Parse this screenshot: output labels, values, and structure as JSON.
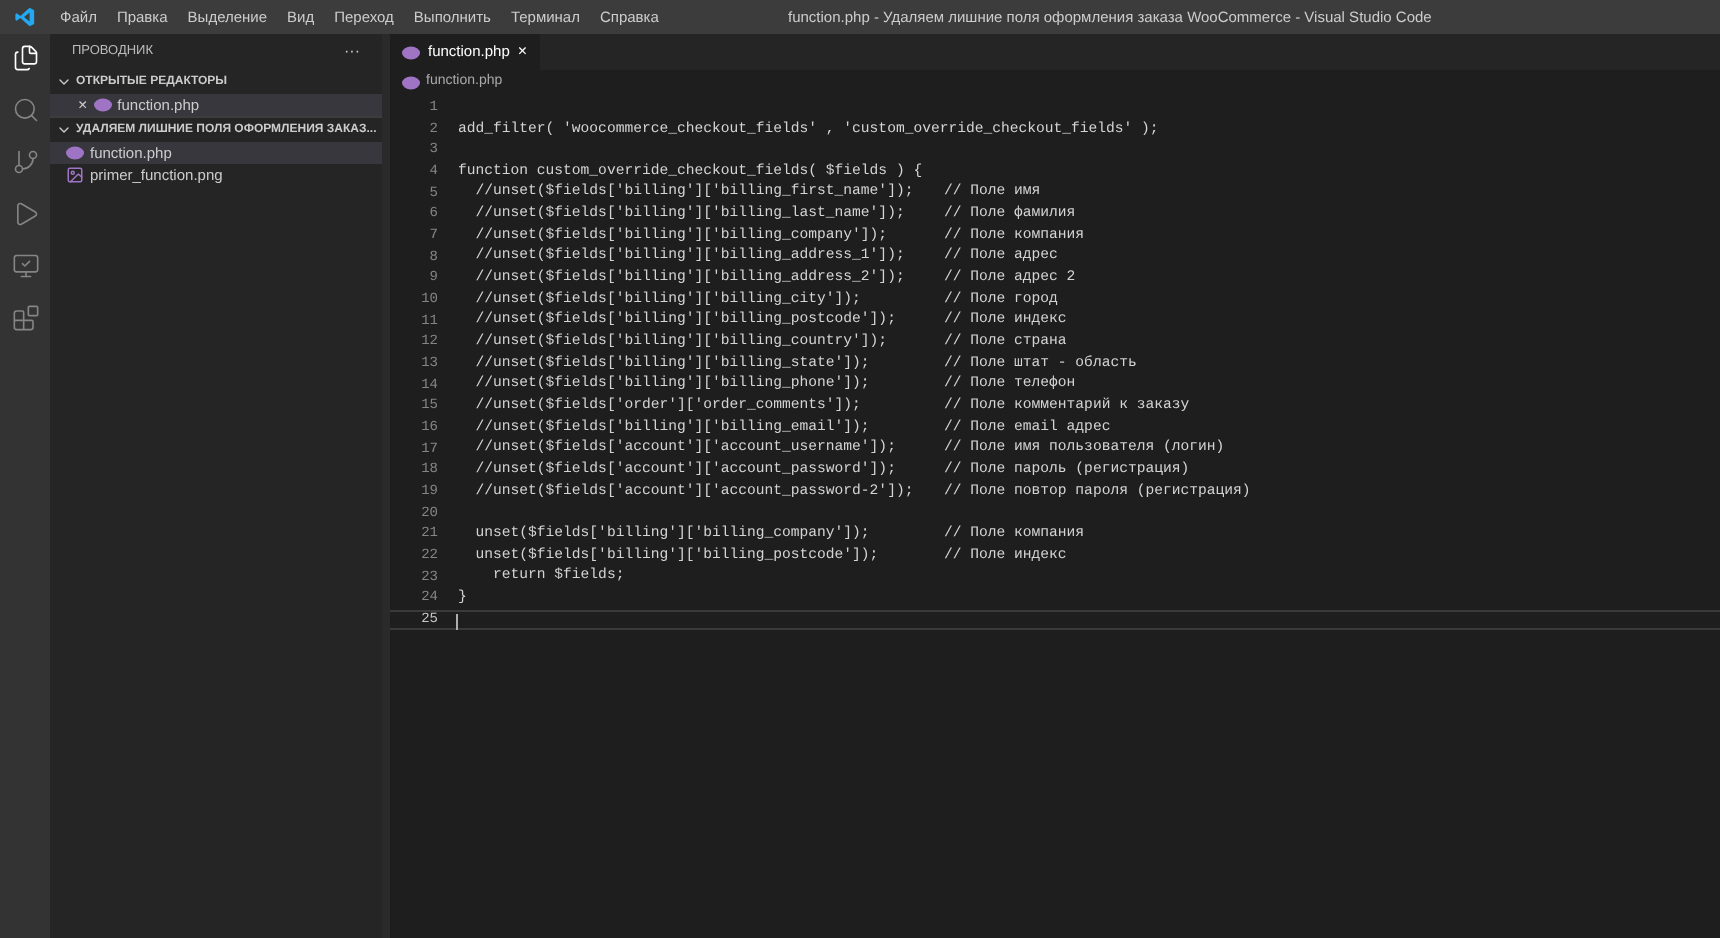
{
  "menu_bar": [
    "Файл",
    "Правка",
    "Выделение",
    "Вид",
    "Переход",
    "Выполнить",
    "Терминал",
    "Справка"
  ],
  "window": {
    "title": "function.php - Удаляем лишние поля оформления заказа WooCommerce - Visual Studio Code"
  },
  "activity_bar": [
    {
      "kind": "files",
      "selected": true
    },
    {
      "kind": "search",
      "selected": false
    },
    {
      "kind": "source-control",
      "selected": false
    },
    {
      "kind": "run",
      "selected": false
    },
    {
      "kind": "remote",
      "selected": false
    },
    {
      "kind": "extensions",
      "selected": false
    }
  ],
  "sidebar": {
    "title": "ПРОВОДНИК",
    "more": "···",
    "sections": [
      {
        "title": "ОТКРЫТЫЕ РЕДАКТОРЫ",
        "expanded": true,
        "items": [
          {
            "label": "function.php",
            "kind": "php",
            "close": "×",
            "selected": true
          }
        ]
      },
      {
        "title": "УДАЛЯЕМ ЛИШНИЕ ПОЛЯ ОФОРМЛЕНИЯ ЗАКАЗ...",
        "expanded": true,
        "items": [
          {
            "label": "function.php",
            "kind": "php",
            "selected": true
          },
          {
            "label": "primer_function.png",
            "kind": "image",
            "selected": false
          }
        ]
      }
    ]
  },
  "tabs": [
    {
      "label": "function.php",
      "close": "×",
      "selected": true
    }
  ],
  "breadcrumb": "function.php",
  "code": [
    {
      "number": "1"
    },
    {
      "number": "2",
      "code": "add_filter( 'woocommerce_checkout_fields' , 'custom_override_checkout_fields' );"
    },
    {
      "number": "3"
    },
    {
      "number": "4",
      "code": "function custom_override_checkout_fields( $fields ) {"
    },
    {
      "number": "5",
      "code": "  //unset($fields['billing']['billing_first_name']);",
      "comment": "// Поле имя"
    },
    {
      "number": "6",
      "code": "  //unset($fields['billing']['billing_last_name']);",
      "comment": "// Поле фамилия"
    },
    {
      "number": "7",
      "code": "  //unset($fields['billing']['billing_company']);",
      "comment": "// Поле компания"
    },
    {
      "number": "8",
      "code": "  //unset($fields['billing']['billing_address_1']);",
      "comment": "// Поле адрес"
    },
    {
      "number": "9",
      "code": "  //unset($fields['billing']['billing_address_2']);",
      "comment": "// Поле адрес 2"
    },
    {
      "number": "10",
      "code": "  //unset($fields['billing']['billing_city']);",
      "comment": "// Поле город"
    },
    {
      "number": "11",
      "code": "  //unset($fields['billing']['billing_postcode']);",
      "comment": "// Поле индекс"
    },
    {
      "number": "12",
      "code": "  //unset($fields['billing']['billing_country']);",
      "comment": "// Поле страна"
    },
    {
      "number": "13",
      "code": "  //unset($fields['billing']['billing_state']);",
      "comment": "// Поле штат - область"
    },
    {
      "number": "14",
      "code": "  //unset($fields['billing']['billing_phone']);",
      "comment": "// Поле телефон"
    },
    {
      "number": "15",
      "code": "  //unset($fields['order']['order_comments']);",
      "comment": "// Поле комментарий к заказу"
    },
    {
      "number": "16",
      "code": "  //unset($fields['billing']['billing_email']);",
      "comment": "// Поле email адрес"
    },
    {
      "number": "17",
      "code": "  //unset($fields['account']['account_username']);",
      "comment": "// Поле имя пользователя (логин)"
    },
    {
      "number": "18",
      "code": "  //unset($fields['account']['account_password']);",
      "comment": "// Поле пароль (регистрация)"
    },
    {
      "number": "19",
      "code": "  //unset($fields['account']['account_password-2']);",
      "comment": "// Поле повтор пароля (регистрация)"
    },
    {
      "number": "20"
    },
    {
      "number": "21",
      "code": "  unset($fields['billing']['billing_company']);",
      "comment": "// Поле компания"
    },
    {
      "number": "22",
      "code": "  unset($fields['billing']['billing_postcode']);",
      "comment": "// Поле индекс"
    },
    {
      "number": "23",
      "code": "    return $fields;"
    },
    {
      "number": "24",
      "code": "}"
    },
    {
      "number": "25",
      "current": true
    }
  ]
}
